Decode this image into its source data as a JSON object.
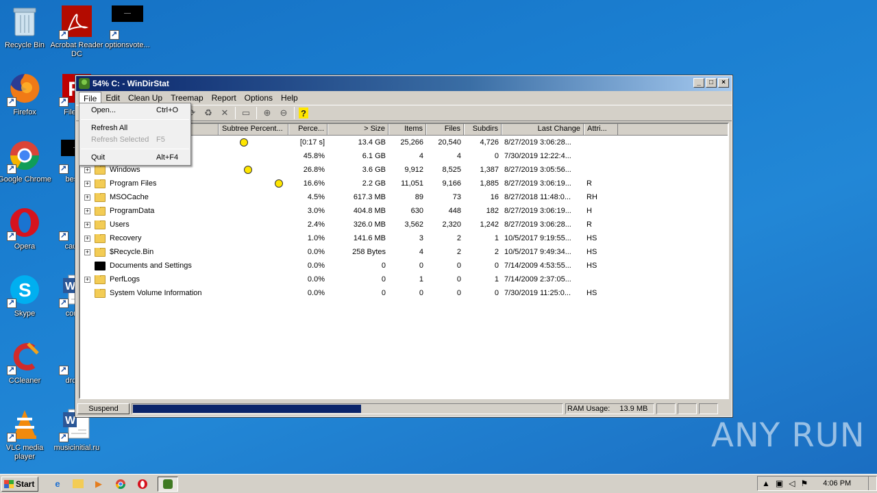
{
  "desktop": {
    "icons": [
      {
        "label": "Recycle Bin",
        "icon": "recycle-bin-icon"
      },
      {
        "label": "Acrobat Reader DC",
        "icon": "acrobat-icon"
      },
      {
        "label": "optionsvote...",
        "icon": "black-file-icon"
      },
      {
        "label": "Firefox",
        "icon": "firefox-icon"
      },
      {
        "label": "FileZilla",
        "icon": "filezilla-icon"
      },
      {
        "label": "Google Chrome",
        "icon": "chrome-icon"
      },
      {
        "label": "besthe",
        "icon": "black-file-icon"
      },
      {
        "label": "Opera",
        "icon": "opera-icon"
      },
      {
        "label": "causec",
        "icon": "file-icon"
      },
      {
        "label": "Skype",
        "icon": "skype-icon"
      },
      {
        "label": "commi",
        "icon": "word-icon"
      },
      {
        "label": "CCleaner",
        "icon": "ccleaner-icon"
      },
      {
        "label": "drcloth",
        "icon": "file-icon"
      },
      {
        "label": "VLC media player",
        "icon": "vlc-icon"
      },
      {
        "label": "musicinitial.ru",
        "icon": "word-icon"
      }
    ],
    "watermark": "ANY RUN"
  },
  "window": {
    "title": "54% C: - WinDirStat",
    "menu": [
      "File",
      "Edit",
      "Clean Up",
      "Treemap",
      "Report",
      "Options",
      "Help"
    ],
    "columns": [
      "Subtree Percent...",
      "Perce...",
      "> Size",
      "Items",
      "Files",
      "Subdirs",
      "Last Change",
      "Attri..."
    ],
    "rows": [
      {
        "name": "",
        "expand": "",
        "pct": "[0:17 s]",
        "size": "13.4 GB",
        "items": "25,266",
        "files": "20,540",
        "subdirs": "4,726",
        "last": "8/27/2019  3:06:28...",
        "attr": "",
        "pac": 0.3
      },
      {
        "name": "",
        "expand": "",
        "pct": "45.8%",
        "size": "6.1 GB",
        "items": "4",
        "files": "4",
        "subdirs": "0",
        "last": "7/30/2019  12:22:4...",
        "attr": "",
        "pac": null
      },
      {
        "name": "Windows",
        "expand": "+",
        "pct": "26.8%",
        "size": "3.6 GB",
        "items": "9,912",
        "files": "8,525",
        "subdirs": "1,387",
        "last": "8/27/2019  3:05:56...",
        "attr": "",
        "pac": 0.36
      },
      {
        "name": "Program Files",
        "expand": "+",
        "pct": "16.6%",
        "size": "2.2 GB",
        "items": "11,051",
        "files": "9,166",
        "subdirs": "1,885",
        "last": "8/27/2019  3:06:19...",
        "attr": "R",
        "pac": 0.8
      },
      {
        "name": "MSOCache",
        "expand": "+",
        "pct": "4.5%",
        "size": "617.3 MB",
        "items": "89",
        "files": "73",
        "subdirs": "16",
        "last": "8/27/2018  11:48:0...",
        "attr": "RH",
        "pac": null
      },
      {
        "name": "ProgramData",
        "expand": "+",
        "pct": "3.0%",
        "size": "404.8 MB",
        "items": "630",
        "files": "448",
        "subdirs": "182",
        "last": "8/27/2019  3:06:19...",
        "attr": "H",
        "pac": null
      },
      {
        "name": "Users",
        "expand": "+",
        "pct": "2.4%",
        "size": "326.0 MB",
        "items": "3,562",
        "files": "2,320",
        "subdirs": "1,242",
        "last": "8/27/2019  3:06:28...",
        "attr": "R",
        "pac": null
      },
      {
        "name": "Recovery",
        "expand": "+",
        "pct": "1.0%",
        "size": "141.6 MB",
        "items": "3",
        "files": "2",
        "subdirs": "1",
        "last": "10/5/2017  9:19:55...",
        "attr": "HS",
        "pac": null
      },
      {
        "name": "$Recycle.Bin",
        "expand": "+",
        "pct": "0.0%",
        "size": "258 Bytes",
        "items": "4",
        "files": "2",
        "subdirs": "2",
        "last": "10/5/2017  9:49:34...",
        "attr": "HS",
        "pac": null
      },
      {
        "name": "Documents and Settings",
        "expand": "",
        "pct": "0.0%",
        "size": "0",
        "items": "0",
        "files": "0",
        "subdirs": "0",
        "last": "7/14/2009  4:53:55...",
        "attr": "HS",
        "pac": null,
        "black": true
      },
      {
        "name": "PerfLogs",
        "expand": "+",
        "pct": "0.0%",
        "size": "0",
        "items": "1",
        "files": "0",
        "subdirs": "1",
        "last": "7/14/2009  2:37:05...",
        "attr": "",
        "pac": null
      },
      {
        "name": "System Volume Information",
        "expand": "",
        "pct": "0.0%",
        "size": "0",
        "items": "0",
        "files": "0",
        "subdirs": "0",
        "last": "7/30/2019  11:25:0...",
        "attr": "HS",
        "pac": null
      }
    ],
    "status": {
      "suspend": "Suspend",
      "progress": 0.53,
      "ram_label": "RAM Usage:",
      "ram_value": "13.9 MB"
    }
  },
  "file_menu": [
    {
      "label": "Open...",
      "shortcut": "Ctrl+O",
      "disabled": false
    },
    {
      "sep": true
    },
    {
      "label": "Refresh All",
      "shortcut": "",
      "disabled": false
    },
    {
      "label": "Refresh Selected",
      "shortcut": "F5",
      "disabled": true
    },
    {
      "sep": true
    },
    {
      "label": "Quit",
      "shortcut": "Alt+F4",
      "disabled": false
    }
  ],
  "taskbar": {
    "start": "Start",
    "clock": "4:06 PM"
  }
}
